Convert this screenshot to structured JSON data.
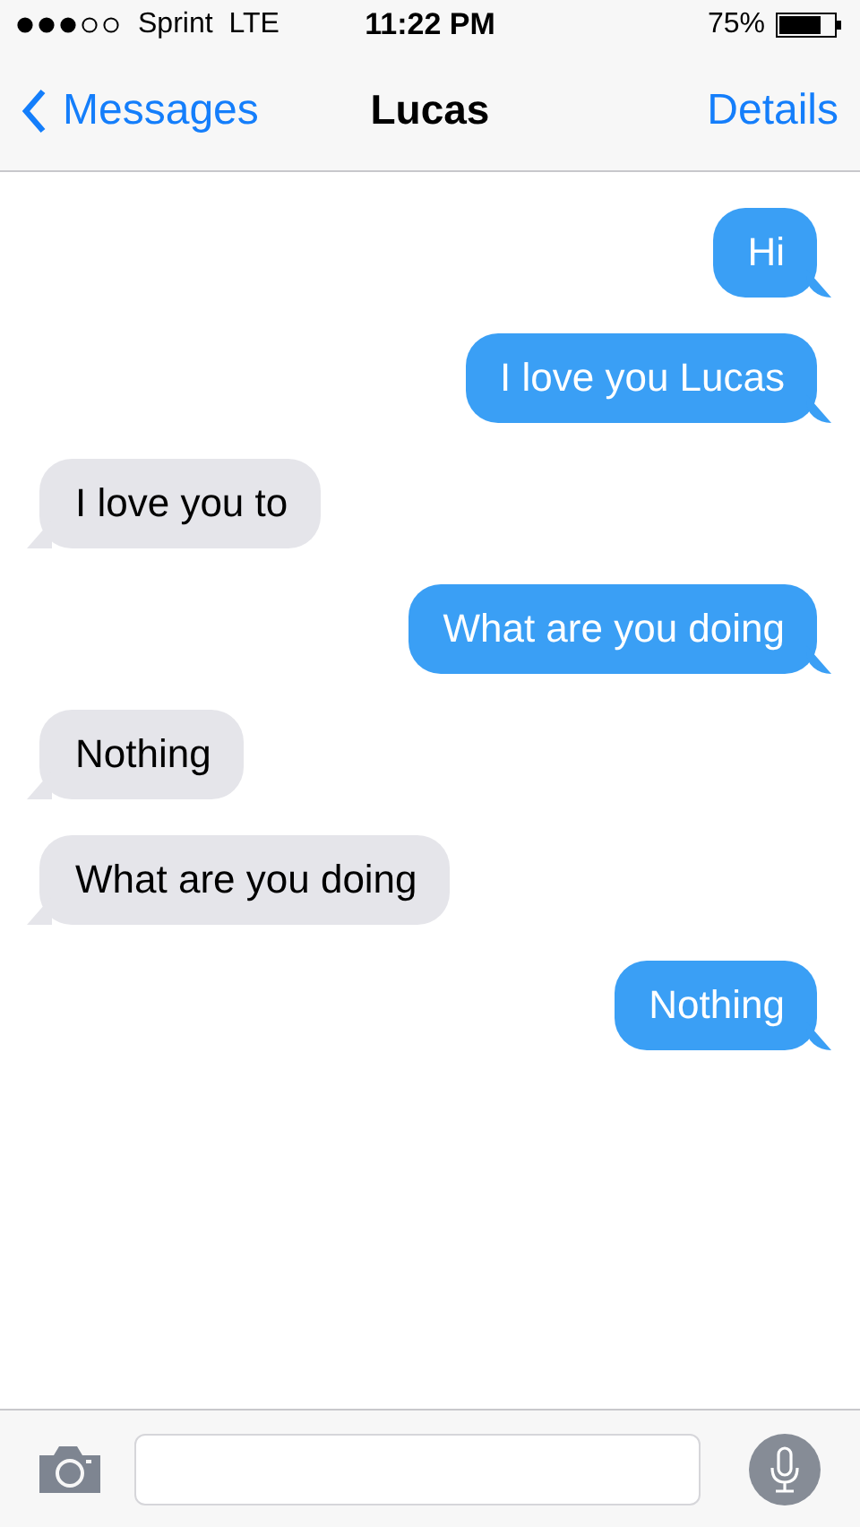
{
  "status_bar": {
    "carrier": "Sprint",
    "network": "LTE",
    "time": "11:22 PM",
    "battery": "75%"
  },
  "nav_bar": {
    "back": "Messages",
    "title": "Lucas",
    "action": "Details"
  },
  "messages": [
    {
      "kind": "sent",
      "text": "Hi"
    },
    {
      "kind": "sent",
      "text": "I love you Lucas"
    },
    {
      "kind": "received",
      "text": "I love you to"
    },
    {
      "kind": "sent",
      "text": "What are you doing"
    },
    {
      "kind": "received",
      "text": "Nothing"
    },
    {
      "kind": "received",
      "text": "What are you doing"
    },
    {
      "kind": "sent",
      "text": "Nothing"
    }
  ]
}
